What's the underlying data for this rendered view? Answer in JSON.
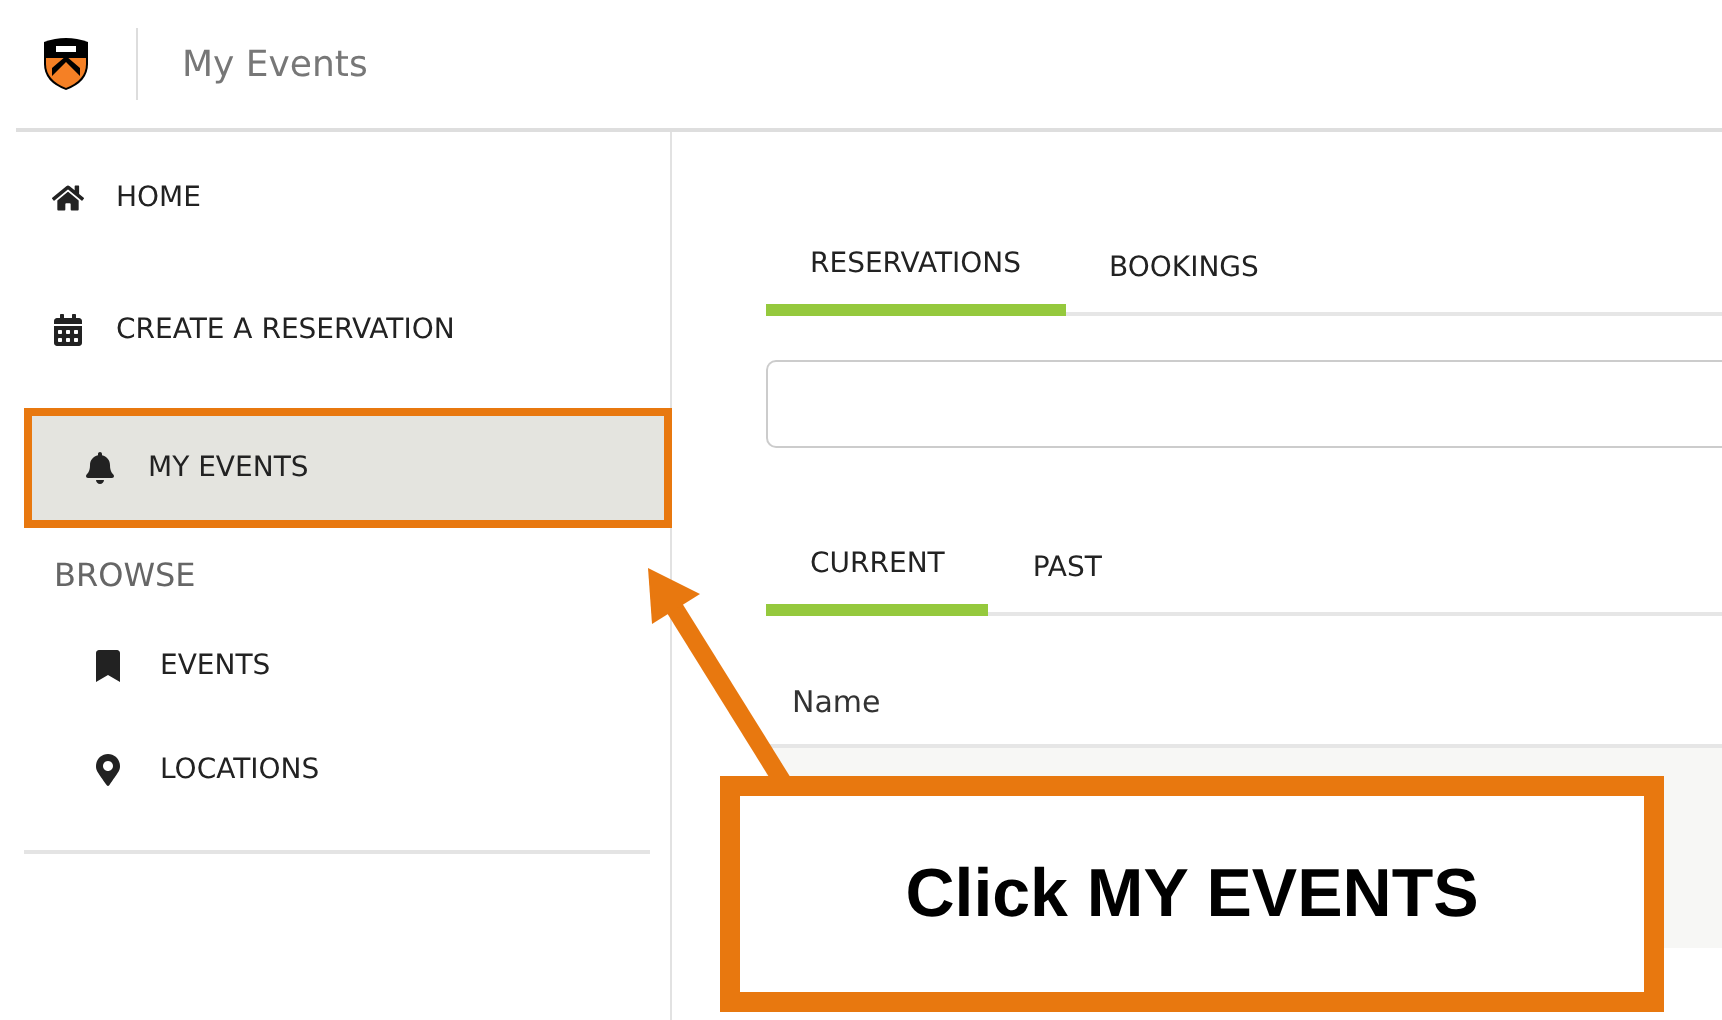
{
  "header": {
    "title": "My Events"
  },
  "sidebar": {
    "items": [
      {
        "label": "HOME",
        "selected": false,
        "highlighted": false
      },
      {
        "label": "CREATE A RESERVATION",
        "selected": false,
        "highlighted": false
      },
      {
        "label": "MY EVENTS",
        "selected": true,
        "highlighted": true
      }
    ],
    "section": {
      "title": "BROWSE",
      "items": [
        {
          "label": "EVENTS"
        },
        {
          "label": "LOCATIONS"
        }
      ]
    }
  },
  "tabs": [
    {
      "label": "RESERVATIONS",
      "selected": true
    },
    {
      "label": "BOOKINGS",
      "selected": false
    }
  ],
  "subtabs": [
    {
      "label": "CURRENT",
      "selected": true
    },
    {
      "label": "PAST",
      "selected": false
    }
  ],
  "table": {
    "columns": [
      "Name"
    ]
  },
  "callout": {
    "text": "Click MY EVENTS"
  }
}
